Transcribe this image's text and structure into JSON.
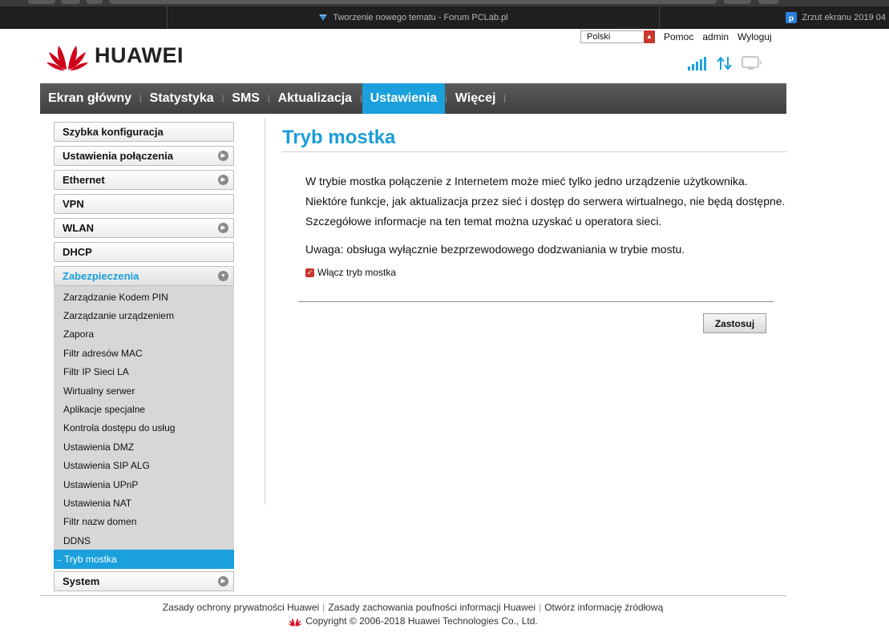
{
  "browser": {
    "tabs": [
      {
        "label": ""
      },
      {
        "label": "Tworzenie nowego tematu - Forum PCLab.pl"
      },
      {
        "label": "Zrzut ekranu 2019 04"
      }
    ]
  },
  "header": {
    "brand": "HUAWEI",
    "language": "Polski",
    "links": {
      "help": "Pomoc",
      "user": "admin",
      "logout": "Wyloguj"
    }
  },
  "nav": {
    "items": [
      {
        "label": "Ekran główny"
      },
      {
        "label": "Statystyka"
      },
      {
        "label": "SMS"
      },
      {
        "label": "Aktualizacja"
      },
      {
        "label": "Ustawienia"
      },
      {
        "label": "Więcej"
      }
    ],
    "separator": "|"
  },
  "sidebar": {
    "top": [
      {
        "label": "Szybka konfiguracja"
      },
      {
        "label": "Ustawienia połączenia"
      },
      {
        "label": "Ethernet"
      },
      {
        "label": "VPN"
      },
      {
        "label": "WLAN"
      },
      {
        "label": "DHCP"
      }
    ],
    "open_section": "Zabezpieczenia",
    "sub_items": [
      {
        "label": "Zarządzanie Kodem PIN"
      },
      {
        "label": "Zarządzanie urządzeniem"
      },
      {
        "label": "Zapora"
      },
      {
        "label": "Filtr adresów MAC"
      },
      {
        "label": "Filtr IP Sieci LA"
      },
      {
        "label": "Wirtualny serwer"
      },
      {
        "label": "Aplikacje specjalne"
      },
      {
        "label": "Kontrola dostępu do usług"
      },
      {
        "label": "Ustawienia DMZ"
      },
      {
        "label": "Ustawienia SIP ALG"
      },
      {
        "label": "Ustawienia UPnP"
      },
      {
        "label": "Ustawienia NAT"
      },
      {
        "label": "Filtr nazw domen"
      },
      {
        "label": "DDNS"
      },
      {
        "label": "Tryb mostka"
      }
    ],
    "bottom": [
      {
        "label": "System"
      }
    ]
  },
  "main": {
    "title": "Tryb mostka",
    "paragraphs": [
      "W trybie mostka połączenie z Internetem może mieć tylko jedno urządzenie użytkownika.",
      "Niektóre funkcje, jak aktualizacja przez sieć i dostęp do serwera wirtualnego, nie będą dostępne.",
      "Szczegółowe informacje na ten temat można uzyskać u operatora sieci.",
      "Uwaga: obsługa wyłącznie bezprzewodowego dodzwaniania w trybie mostu."
    ],
    "checkbox_label": "Włącz tryb mostka",
    "checkbox_checked": true,
    "apply_label": "Zastosuj"
  },
  "footer": {
    "links": [
      "Zasady ochrony prywatności Huawei",
      "Zasady zachowania poufności informacji Huawei",
      "Otwórz informację źródłową"
    ],
    "copyright": "Copyright © 2006-2018 Huawei Technologies Co., Ltd."
  },
  "colors": {
    "accent": "#1aa0dc",
    "brand_red": "#c9372c",
    "nav_bg": "#4a4a4a"
  },
  "icons": {
    "signal": "signal-bars-icon",
    "transfer": "data-transfer-icon",
    "device": "monitor-icon",
    "expand": "arrow-circle-icon",
    "collapse": "chevron-down-circle-icon"
  }
}
